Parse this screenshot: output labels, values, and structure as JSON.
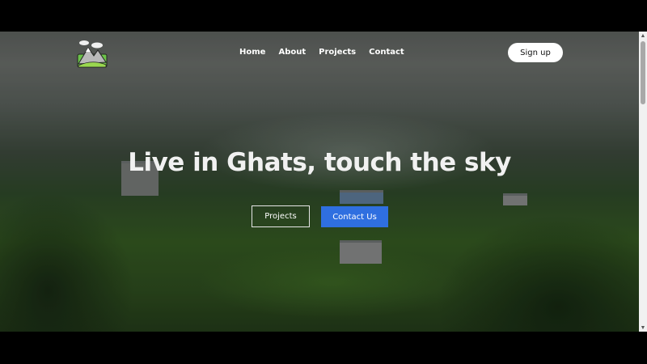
{
  "nav": {
    "logo": "mountain-logo-icon",
    "links": [
      "Home",
      "About",
      "Projects",
      "Contact"
    ],
    "signup_label": "Sign up"
  },
  "hero": {
    "title": "Live in Ghats, touch the sky",
    "primary_label": "Projects",
    "secondary_label": "Contact Us"
  },
  "colors": {
    "accent": "#2f6fe0",
    "signup_bg": "#ffffff",
    "title_color": "#f1f1f1"
  },
  "scrollbar": {
    "up_icon": "scroll-up-arrow-icon",
    "down_icon": "scroll-down-arrow-icon"
  }
}
